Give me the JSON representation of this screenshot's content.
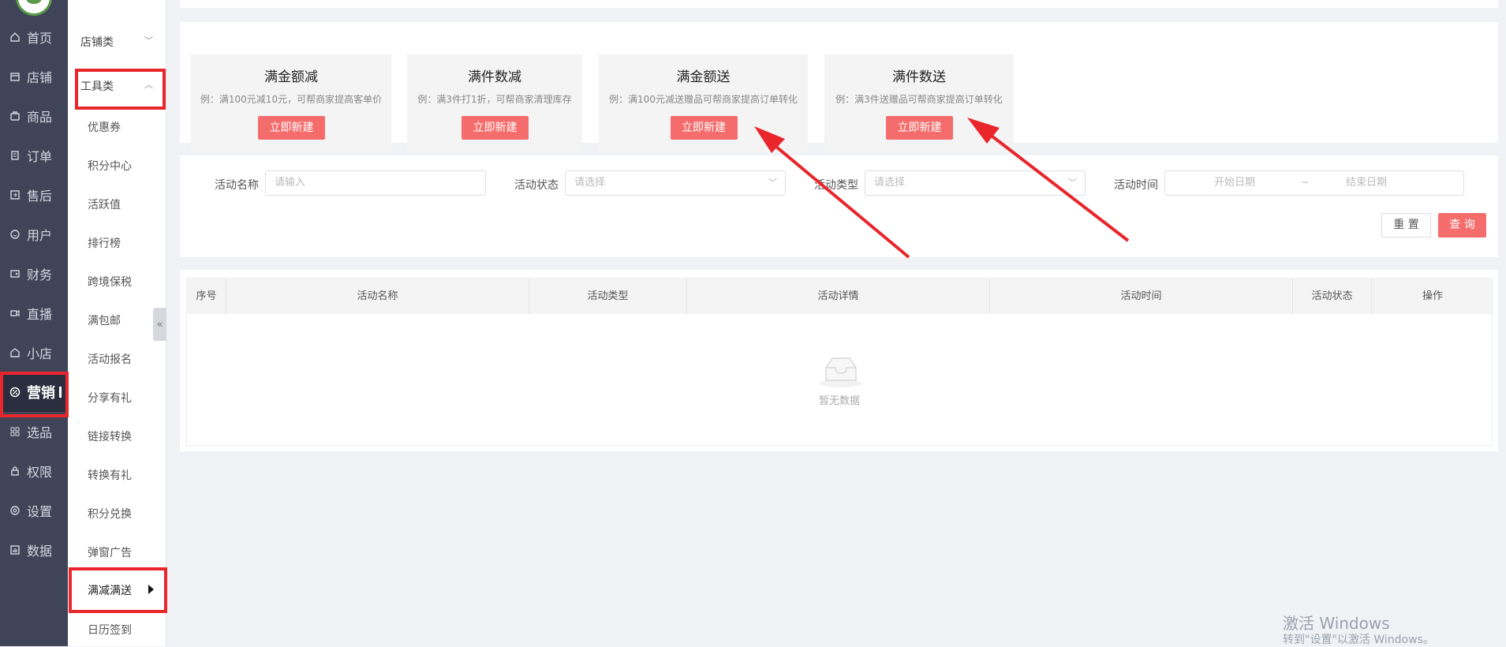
{
  "rail": {
    "items": [
      {
        "label": "首页",
        "icon": "home-icon"
      },
      {
        "label": "店铺",
        "icon": "shop-icon"
      },
      {
        "label": "商品",
        "icon": "goods-icon"
      },
      {
        "label": "订单",
        "icon": "order-icon"
      },
      {
        "label": "售后",
        "icon": "aftersale-icon"
      },
      {
        "label": "用户",
        "icon": "user-icon"
      },
      {
        "label": "财务",
        "icon": "finance-icon"
      },
      {
        "label": "直播",
        "icon": "live-icon"
      },
      {
        "label": "小店",
        "icon": "store-icon"
      },
      {
        "label": "营销",
        "icon": "marketing-icon"
      },
      {
        "label": "选品",
        "icon": "select-icon"
      },
      {
        "label": "权限",
        "icon": "lock-icon"
      },
      {
        "label": "设置",
        "icon": "gear-icon"
      },
      {
        "label": "数据",
        "icon": "chart-icon"
      }
    ]
  },
  "submenu": {
    "group1": "店铺类",
    "group2": "工具类",
    "items": [
      "优惠券",
      "积分中心",
      "活跃值",
      "排行榜",
      "跨境保税",
      "满包邮",
      "活动报名",
      "分享有礼",
      "链接转换",
      "转换有礼",
      "积分兑换",
      "弹窗广告",
      "满减满送",
      "日历签到"
    ]
  },
  "cards": [
    {
      "title": "满金额减",
      "desc": "例：满100元减10元，可帮商家提高客单价",
      "button": "立即新建"
    },
    {
      "title": "满件数减",
      "desc": "例：满3件打1折，可帮商家清理库存",
      "button": "立即新建"
    },
    {
      "title": "满金额送",
      "desc": "例：满100元减送赠品可帮商家提高订单转化",
      "button": "立即新建"
    },
    {
      "title": "满件数送",
      "desc": "例：满3件送赠品可帮商家提高订单转化",
      "button": "立即新建"
    }
  ],
  "filters": {
    "name_label": "活动名称",
    "name_placeholder": "请输入",
    "status_label": "活动状态",
    "status_placeholder": "请选择",
    "type_label": "活动类型",
    "type_placeholder": "请选择",
    "time_label": "活动时间",
    "start_placeholder": "开始日期",
    "range_sep": "~",
    "end_placeholder": "结束日期",
    "reset": "重 置",
    "query": "查 询"
  },
  "table": {
    "columns": [
      "序号",
      "活动名称",
      "活动类型",
      "活动详情",
      "活动时间",
      "活动状态",
      "操作"
    ],
    "empty": "暂无数据"
  },
  "watermark": {
    "line1": "激活 Windows",
    "line2": "转到\"设置\"以激活 Windows。"
  }
}
